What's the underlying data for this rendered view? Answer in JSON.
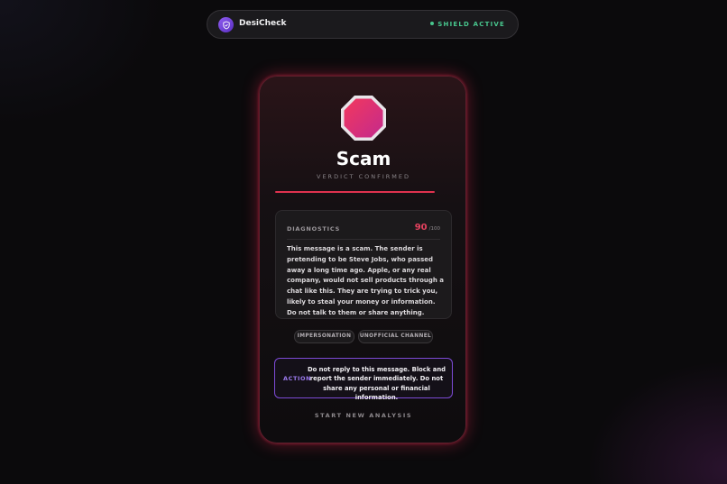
{
  "header": {
    "app_name": "DesiCheck",
    "logo_icon": "shield-check-icon",
    "status_label": "SHIELD ACTIVE",
    "status_color": "#48c78e"
  },
  "result": {
    "verdict_icon": "stop-octagon-icon",
    "verdict": "Scam",
    "verdict_subtitle": "VERDICT CONFIRMED",
    "accent_color": "#e0324f"
  },
  "diagnostics": {
    "label": "DIAGNOSTICS",
    "score": "90",
    "score_max": "/100",
    "summary": "This message is a scam. The sender is pretending to be Steve Jobs, who passed away a long time ago. Apple, or any real company, would not sell products through a chat like this. They are trying to trick you, likely to steal your money or information. Do not talk to them or share anything."
  },
  "tags": [
    "IMPERSONATION",
    "UNOFFICIAL CHANNEL"
  ],
  "action": {
    "label": "ACTION",
    "text": "Do not reply to this message. Block and report the sender immediately. Do not share any personal or financial information."
  },
  "footer": {
    "new_analysis_label": "START NEW ANALYSIS"
  }
}
